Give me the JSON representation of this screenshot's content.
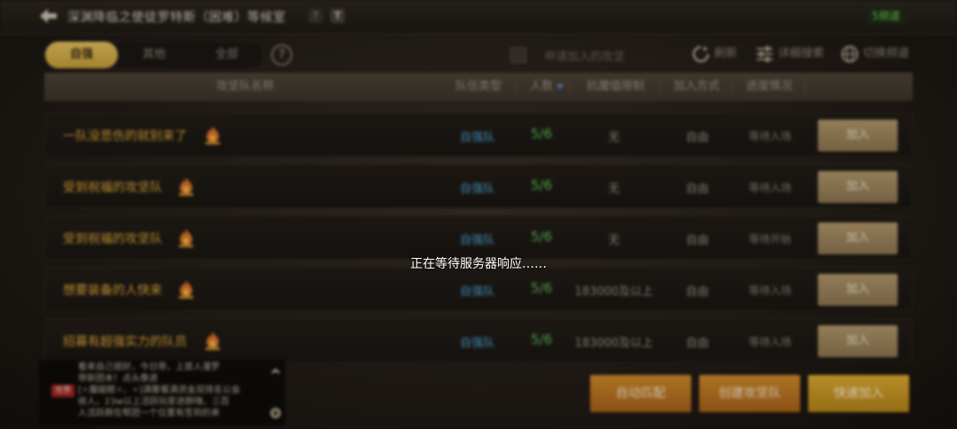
{
  "topbar": {
    "title": "深渊降临之使徒罗特斯（困难）等候室",
    "help_glyph": "?",
    "text_glyph": "T",
    "channel": "5频道"
  },
  "filters": {
    "tabs": [
      {
        "label": "自强",
        "active": true
      },
      {
        "label": "其他",
        "active": false
      },
      {
        "label": "全部",
        "active": false
      }
    ],
    "help_glyph": "?",
    "apply_label": "申请加入的攻坚",
    "refresh_label": "刷新",
    "search_label": "详细搜索",
    "switch_channel_label": "切换频道"
  },
  "table": {
    "headers": {
      "name": "攻坚队名称",
      "type": "队伍类型",
      "count": "人数",
      "limit": "抗魔值限制",
      "method": "加入方式",
      "status": "进度情况"
    },
    "rows": [
      {
        "name": "一队没悲伤的就别来了",
        "type": "自强队",
        "count": "5/6",
        "limit": "无",
        "method": "自由",
        "status": "等待入场",
        "join": "加入"
      },
      {
        "name": "受到祝福的攻坚队",
        "type": "自强队",
        "count": "5/6",
        "limit": "无",
        "method": "自由",
        "status": "等待入场",
        "join": "加入"
      },
      {
        "name": "受到祝福的攻坚队",
        "type": "自强队",
        "count": "5/6",
        "limit": "无",
        "method": "自由",
        "status": "等待开始",
        "join": "加入"
      },
      {
        "name": "想要装备的人快来",
        "type": "自强队",
        "count": "5/6",
        "limit": "183000及以上",
        "method": "自由",
        "status": "等待入场",
        "join": "加入"
      },
      {
        "name": "招募有超强实力的队员",
        "type": "自强队",
        "count": "5/6",
        "limit": "183000及以上",
        "method": "自由",
        "status": "等待入场",
        "join": "加入"
      }
    ]
  },
  "chat": {
    "world_tag": "世界",
    "lines": [
      "看来自己很好，今日带，上首人漫罗",
      "带新团本！点头像进",
      "[✧魔磁眼✧、✧]满聚餐满资金双排名公会",
      "收人，23w以上活跃玩家进群嗨，三百",
      "人活跃群在帮团一个位置有签到的来"
    ]
  },
  "buttons": {
    "auto_match": "自动匹配",
    "create_team": "创建攻坚队",
    "quick_join": "快速加入"
  },
  "overlay": {
    "message": "正在等待服务器响应……"
  },
  "colors": {
    "accent_gold": "#e0ae33",
    "team_name": "#e0a93a",
    "team_type": "#4da7d8",
    "member_count": "#62c257",
    "channel_green": "#6fd048"
  }
}
